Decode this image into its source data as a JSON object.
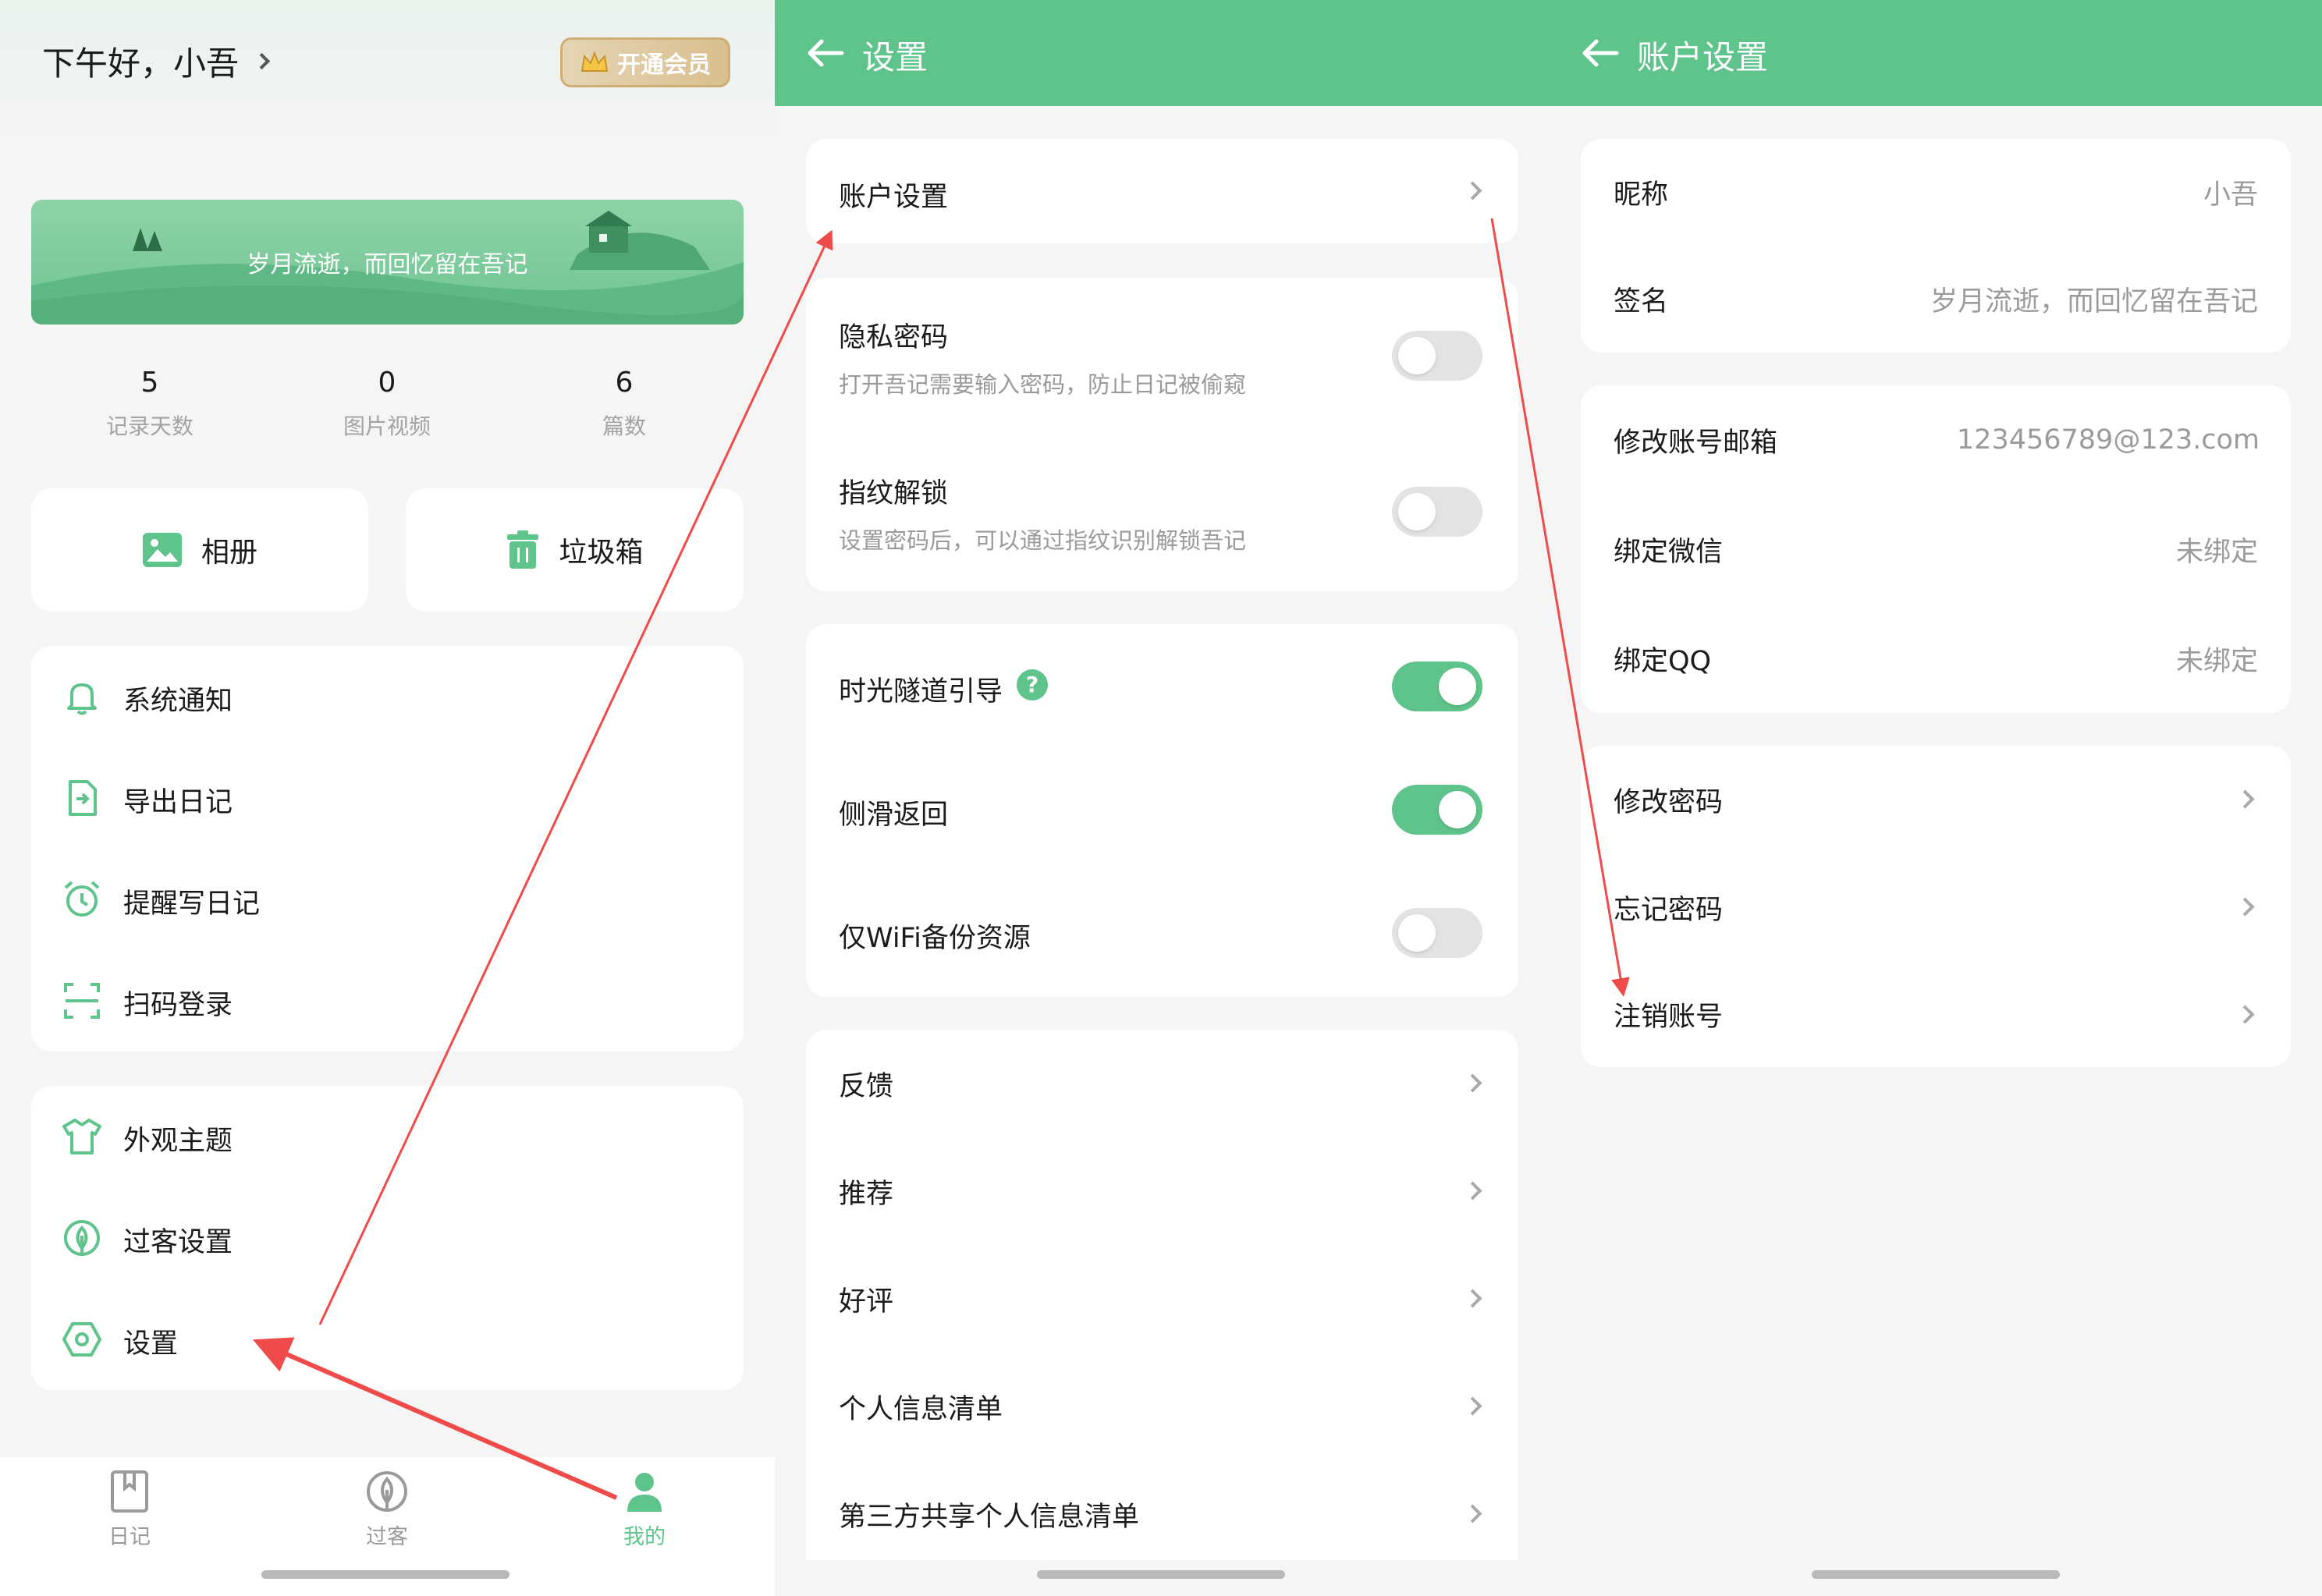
{
  "profile": {
    "greeting": "下午好，小吾",
    "vip_label": "开通会员",
    "banner_text": "岁月流逝，而回忆留在吾记",
    "stats": [
      {
        "value": "5",
        "label": "记录天数"
      },
      {
        "value": "0",
        "label": "图片视频"
      },
      {
        "value": "6",
        "label": "篇数"
      }
    ],
    "album_label": "相册",
    "trash_label": "垃圾箱",
    "menu1": [
      "系统通知",
      "导出日记",
      "提醒写日记",
      "扫码登录"
    ],
    "menu2": [
      "外观主题",
      "过客设置",
      "设置"
    ],
    "tabs": [
      "日记",
      "过客",
      "我的"
    ]
  },
  "settings": {
    "title": "设置",
    "account_label": "账户设置",
    "privacy_label": "隐私密码",
    "privacy_sub": "打开吾记需要输入密码，防止日记被偷窥",
    "privacy_on": false,
    "fingerprint_label": "指纹解锁",
    "fingerprint_sub": "设置密码后，可以通过指纹识别解锁吾记",
    "fingerprint_on": false,
    "tunnel_label": "时光隧道引导",
    "tunnel_on": true,
    "swipe_label": "侧滑返回",
    "swipe_on": true,
    "wifi_label": "仅WiFi备份资源",
    "wifi_on": false,
    "links": [
      "反馈",
      "推荐",
      "好评",
      "个人信息清单",
      "第三方共享个人信息清单"
    ]
  },
  "account": {
    "title": "账户设置",
    "nickname_label": "昵称",
    "nickname_value": "小吾",
    "signature_label": "签名",
    "signature_value": "岁月流逝，而回忆留在吾记",
    "email_label": "修改账号邮箱",
    "email_value": "123456789@123.com",
    "wechat_label": "绑定微信",
    "wechat_value": "未绑定",
    "qq_label": "绑定QQ",
    "qq_value": "未绑定",
    "change_pwd_label": "修改密码",
    "forgot_pwd_label": "忘记密码",
    "delete_label": "注销账号"
  },
  "colors": {
    "brand_green": "#5fc48b",
    "annotation_red": "#ef4b4b"
  }
}
